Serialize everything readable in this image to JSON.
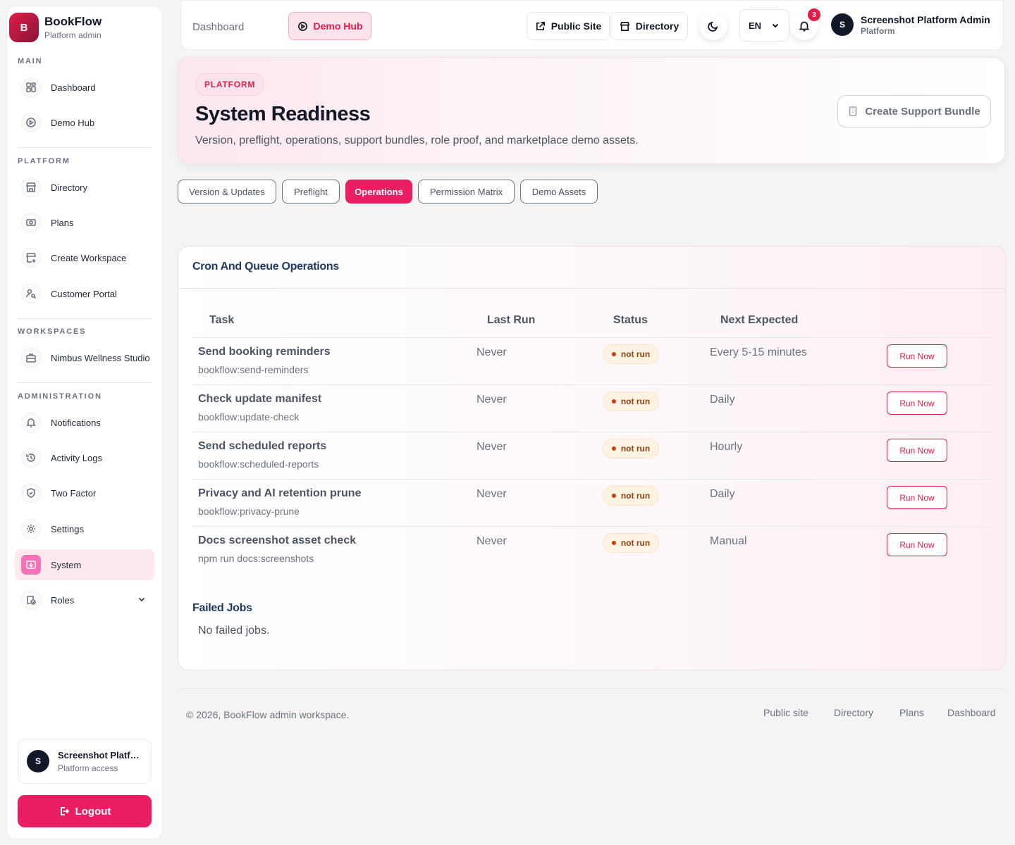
{
  "brand": {
    "logo_letter": "B",
    "name": "BookFlow",
    "subtitle": "Platform admin"
  },
  "sidebar": {
    "sections": [
      {
        "title": "MAIN"
      },
      {
        "title": "PLATFORM"
      },
      {
        "title": "WORKSPACES"
      },
      {
        "title": "ADMINISTRATION"
      }
    ],
    "items": [
      {
        "label": "Dashboard",
        "icon": "dashboard-icon"
      },
      {
        "label": "Demo Hub",
        "icon": "play-circle-icon"
      },
      {
        "label": "Directory",
        "icon": "store-icon"
      },
      {
        "label": "Plans",
        "icon": "money-icon"
      },
      {
        "label": "Create Workspace",
        "icon": "store-add-icon"
      },
      {
        "label": "Customer Portal",
        "icon": "user-search-icon"
      },
      {
        "label": "Nimbus Wellness Studio",
        "icon": "briefcase-icon"
      },
      {
        "label": "Notifications",
        "icon": "bell-icon"
      },
      {
        "label": "Activity Logs",
        "icon": "history-icon"
      },
      {
        "label": "Two Factor",
        "icon": "shield-check-icon"
      },
      {
        "label": "Settings",
        "icon": "gear-icon"
      },
      {
        "label": "System",
        "icon": "system-download-icon",
        "active": true
      },
      {
        "label": "Roles",
        "icon": "roles-icon"
      }
    ],
    "user": {
      "initial": "S",
      "name": "Screenshot Platform Admin",
      "subtitle": "Platform access"
    },
    "logout_label": "Logout"
  },
  "topbar": {
    "breadcrumb": "Dashboard",
    "demo_hub_label": "Demo Hub",
    "public_site_label": "Public Site",
    "directory_label": "Directory",
    "language": "EN",
    "notification_count": "3",
    "user": {
      "initial": "S",
      "name": "Screenshot Platform Admin",
      "role": "Platform"
    }
  },
  "header": {
    "tag": "PLATFORM",
    "title": "System Readiness",
    "description": "Version, preflight, operations, support bundles, role proof, and marketplace demo assets.",
    "support_button": "Create Support Bundle"
  },
  "tabs": [
    {
      "label": "Version & Updates"
    },
    {
      "label": "Preflight"
    },
    {
      "label": "Operations",
      "active": true
    },
    {
      "label": "Permission Matrix"
    },
    {
      "label": "Demo Assets"
    }
  ],
  "operations": {
    "title": "Cron And Queue Operations",
    "columns": [
      "Task",
      "Last Run",
      "Status",
      "Next Expected"
    ],
    "rows": [
      {
        "name": "Send booking reminders",
        "command": "bookflow:send-reminders",
        "last_run": "Never",
        "status": "not run",
        "next": "Every 5-15 minutes",
        "action": "Run Now"
      },
      {
        "name": "Check update manifest",
        "command": "bookflow:update-check",
        "last_run": "Never",
        "status": "not run",
        "next": "Daily",
        "action": "Run Now"
      },
      {
        "name": "Send scheduled reports",
        "command": "bookflow:scheduled-reports",
        "last_run": "Never",
        "status": "not run",
        "next": "Hourly",
        "action": "Run Now"
      },
      {
        "name": "Privacy and AI retention prune",
        "command": "bookflow:privacy-prune",
        "last_run": "Never",
        "status": "not run",
        "next": "Daily",
        "action": "Run Now"
      },
      {
        "name": "Docs screenshot asset check",
        "command": "npm run docs:screenshots",
        "last_run": "Never",
        "status": "not run",
        "next": "Manual",
        "action": "Run Now"
      }
    ],
    "failed_title": "Failed Jobs",
    "failed_empty": "No failed jobs."
  },
  "footer": {
    "copyright": "© 2026, BookFlow admin workspace.",
    "links": [
      "Public site",
      "Directory",
      "Plans",
      "Dashboard"
    ]
  },
  "colors": {
    "accent": "#e91e63",
    "heading": "#1e3a5f",
    "status_bg": "#fef3e2"
  }
}
